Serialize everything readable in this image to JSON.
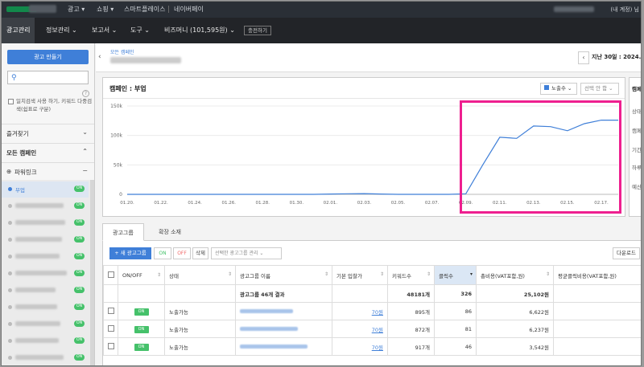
{
  "topbar": {
    "nav": [
      "광고",
      "쇼핑",
      "스마트플레이스",
      "네이버페이"
    ],
    "user_suffix": "(내 계정) 님"
  },
  "mainnav": {
    "items": [
      "광고관리",
      "정보관리",
      "보고서",
      "도구",
      "비즈머니 (101,595원)"
    ],
    "excel": "충전하기"
  },
  "sidebar": {
    "create_button": "광고 만들기",
    "help": "?",
    "checkbox_label": "일치검색 사용 하기, 키워드 다중검색(쉼표로 구분)",
    "favorites": "즐겨찾기",
    "all_campaigns": "모든 캠페인",
    "powerlink": "파워링크",
    "first_item": "부업",
    "toggle_on": "ON"
  },
  "header": {
    "breadcrumb": "모든 캠페인",
    "date_label": "지난 30일 : 2024.0"
  },
  "chart_box": {
    "title": "캠페인 : 부업",
    "metric_select": "노출수",
    "compare_select": "선택 안 함"
  },
  "right_panel": {
    "title": "캠페",
    "rows": [
      "상태",
      "캠페",
      "기간",
      "하루",
      "예산"
    ]
  },
  "chart_data": {
    "type": "line",
    "title": "캠페인 : 부업",
    "categories": [
      "01.20.",
      "01.22.",
      "01.24.",
      "01.26.",
      "01.28.",
      "01.30.",
      "02.01.",
      "02.03.",
      "02.05.",
      "02.07.",
      "02.09.",
      "02.11.",
      "02.13.",
      "02.15.",
      "02.17."
    ],
    "x": [
      "01.20.",
      "01.21.",
      "01.22.",
      "01.23.",
      "01.24.",
      "01.25.",
      "01.26.",
      "01.27.",
      "01.28.",
      "01.29.",
      "01.30.",
      "01.31.",
      "02.01.",
      "02.02.",
      "02.03.",
      "02.04.",
      "02.05.",
      "02.06.",
      "02.07.",
      "02.08.",
      "02.09.",
      "02.10.",
      "02.11.",
      "02.12.",
      "02.13.",
      "02.14.",
      "02.15.",
      "02.16.",
      "02.17.",
      "02.18."
    ],
    "series": [
      {
        "name": "노출수",
        "values": [
          0,
          0,
          0,
          0,
          0,
          0,
          0,
          0,
          0,
          0,
          0,
          0,
          500,
          1000,
          1200,
          600,
          0,
          0,
          0,
          0,
          1000,
          50000,
          97000,
          95000,
          116000,
          115000,
          108000,
          120000,
          126000,
          126000
        ]
      }
    ],
    "yticks": [
      "0",
      "50k",
      "100k",
      "150k"
    ],
    "ylim": [
      0,
      150000
    ],
    "line_color": "#3f7fd8"
  },
  "tabs": [
    "광고그룹",
    "확장 소재"
  ],
  "toolbar": {
    "new": "+ 새 광고그룹",
    "on": "ON",
    "off": "OFF",
    "delete": "삭제",
    "manage": "선택한 광고그룹 관리",
    "download": "다운로드"
  },
  "table": {
    "headers": [
      "ON/OFF",
      "상태",
      "광고그룹 이름",
      "기본 입찰가",
      "키워드수",
      "클릭수",
      "총비용(VAT포함,원)",
      "평균클릭비용(VAT포함,원)"
    ],
    "summary": {
      "name": "광고그룹 46개 결과",
      "keywords": "48181개",
      "clicks": "326",
      "cost": "25,102원"
    },
    "rows": [
      {
        "toggle": "ON",
        "status": "노출가능",
        "bid": "70원",
        "keywords": "895개",
        "clicks": "86",
        "cost": "6,622원"
      },
      {
        "toggle": "ON",
        "status": "노출가능",
        "bid": "70원",
        "keywords": "872개",
        "clicks": "81",
        "cost": "6,237원"
      },
      {
        "toggle": "ON",
        "status": "노출가능",
        "bid": "70원",
        "keywords": "917개",
        "clicks": "46",
        "cost": "3,542원"
      }
    ]
  }
}
